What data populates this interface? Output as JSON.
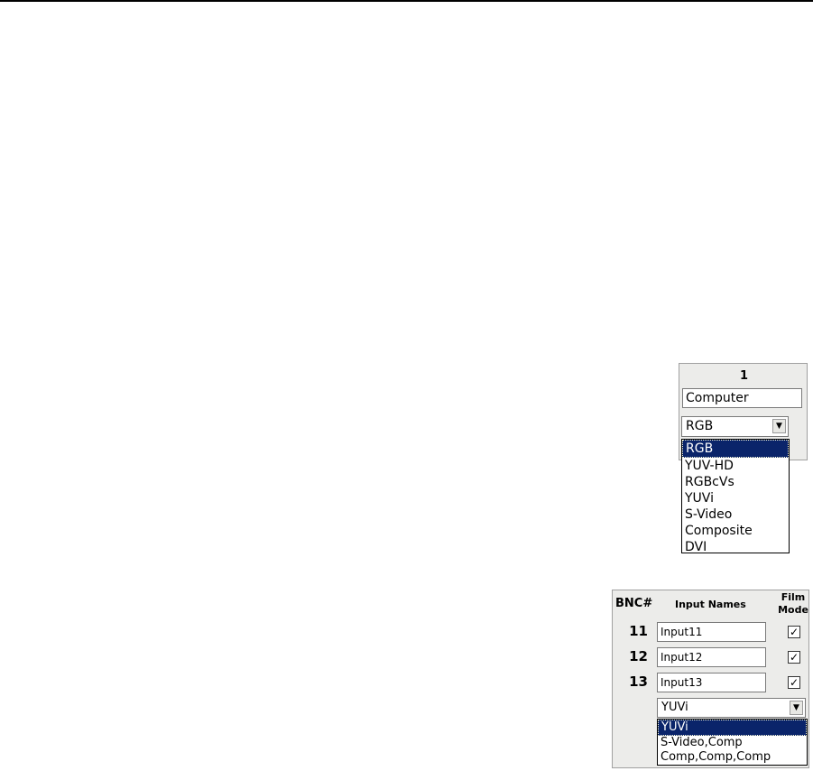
{
  "panel1": {
    "number": "1",
    "input_name": "Computer",
    "format_select": {
      "value": "RGB",
      "options": [
        "RGB",
        "YUV-HD",
        "RGBcVs",
        "YUVi",
        "S-Video",
        "Composite",
        "DVI"
      ]
    }
  },
  "panel2": {
    "headers": {
      "bnc": "BNC#",
      "names": "Input Names",
      "film_mode_line1": "Film",
      "film_mode_line2": "Mode"
    },
    "rows": [
      {
        "bnc": "11",
        "name": "Input11",
        "film_mode": "✓"
      },
      {
        "bnc": "12",
        "name": "Input12",
        "film_mode": "✓"
      },
      {
        "bnc": "13",
        "name": "Input13",
        "film_mode": "✓"
      }
    ],
    "format_select": {
      "value": "YUVi",
      "options": [
        "YUVi",
        "S-Video,Comp",
        "Comp,Comp,Comp"
      ]
    }
  },
  "icons": {
    "dropdown_arrow": "▼"
  }
}
